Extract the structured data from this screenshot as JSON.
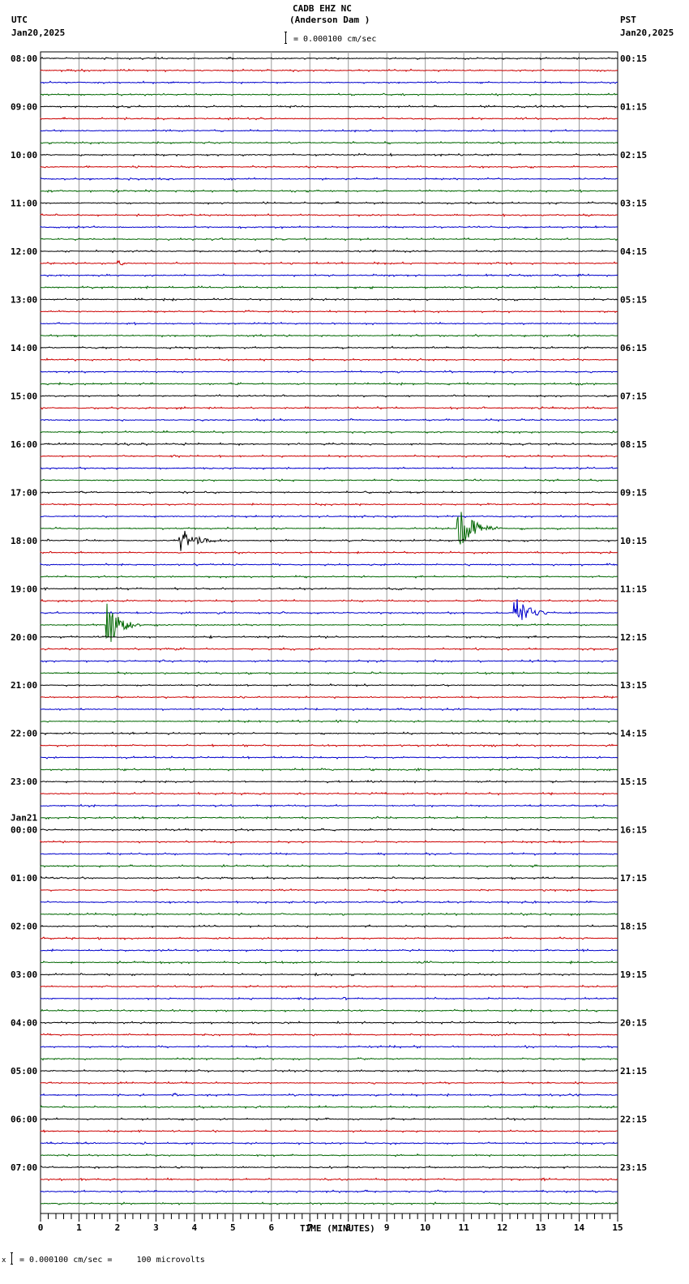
{
  "header": {
    "station": "CADB EHZ NC",
    "location": "(Anderson Dam )",
    "scale": "= 0.000100 cm/sec",
    "left_tz": "UTC",
    "left_date": "Jan20,2025",
    "right_tz": "PST",
    "right_date": "Jan20,2025"
  },
  "footer": {
    "scale_note": "= 0.000100 cm/sec =     100 microvolts"
  },
  "chart_data": {
    "type": "line",
    "title": "CADB EHZ NC (Anderson Dam )",
    "xlabel": "TIME (MINUTES)",
    "xlim": [
      0,
      15
    ],
    "x_ticks": [
      "0",
      "1",
      "2",
      "3",
      "4",
      "5",
      "6",
      "7",
      "8",
      "9",
      "10",
      "11",
      "12",
      "13",
      "14",
      "15"
    ],
    "traces_per_hour": 4,
    "trace_minutes": 15,
    "trace_colors": [
      "#000000",
      "#cc0000",
      "#0000cc",
      "#006600"
    ],
    "left_labels": [
      "08:00",
      "09:00",
      "10:00",
      "11:00",
      "12:00",
      "13:00",
      "14:00",
      "15:00",
      "16:00",
      "17:00",
      "18:00",
      "19:00",
      "20:00",
      "21:00",
      "22:00",
      "23:00",
      "00:00",
      "01:00",
      "02:00",
      "03:00",
      "04:00",
      "05:00",
      "06:00",
      "07:00"
    ],
    "date_change_label": "Jan21",
    "date_change_index": 16,
    "right_labels": [
      "00:15",
      "01:15",
      "02:15",
      "03:15",
      "04:15",
      "05:15",
      "06:15",
      "07:15",
      "08:15",
      "09:15",
      "10:15",
      "11:15",
      "12:15",
      "13:15",
      "14:15",
      "15:15",
      "16:15",
      "17:15",
      "18:15",
      "19:15",
      "20:15",
      "21:15",
      "22:15",
      "23:15"
    ],
    "events": [
      {
        "trace": 17,
        "minute": 2.1,
        "amplitude": 0.2,
        "duration": 0.2
      },
      {
        "trace": 39,
        "minute": 10.9,
        "amplitude": 1.6,
        "duration": 1.1
      },
      {
        "trace": 40,
        "minute": 3.7,
        "amplitude": 1.0,
        "duration": 1.0
      },
      {
        "trace": 46,
        "minute": 12.4,
        "amplitude": 1.2,
        "duration": 0.9
      },
      {
        "trace": 47,
        "minute": 1.8,
        "amplitude": 1.8,
        "duration": 0.8
      },
      {
        "trace": 86,
        "minute": 3.5,
        "amplitude": 0.2,
        "duration": 0.3
      }
    ]
  }
}
